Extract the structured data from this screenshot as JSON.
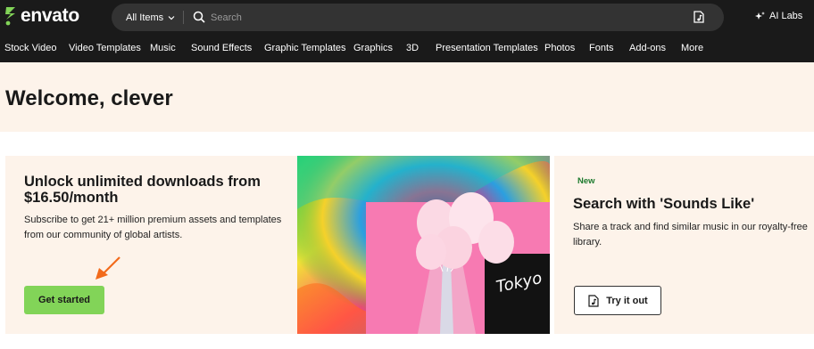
{
  "header": {
    "logo_text": "envato",
    "search": {
      "filter_label": "All Items",
      "placeholder": "Search"
    },
    "ai_labs_label": "AI Labs"
  },
  "categories": [
    "Stock Video",
    "Video Templates",
    "Music",
    "Sound Effects",
    "Graphic Templates",
    "Graphics",
    "3D",
    "Presentation Templates",
    "Photos",
    "Fonts",
    "Add-ons",
    "More"
  ],
  "welcome": {
    "heading": "Welcome, clever"
  },
  "promo": {
    "title": "Unlock unlimited downloads from $16.50/month",
    "description": "Subscribe to get 21+ million premium assets and templates from our community of global artists.",
    "button_label": "Get started"
  },
  "sounds_like": {
    "badge": "New",
    "title": "Search with 'Sounds Like'",
    "description": "Share a track and find similar music in our royalty-free library.",
    "button_label": "Try it out"
  },
  "colors": {
    "topbar_bg": "#1a1a1a",
    "brand_green": "#82d458",
    "cream_bg": "#fdf3ea",
    "arrow_orange": "#f26a1b"
  },
  "icons": [
    "envato-leaf-icon",
    "chevron-down-icon",
    "search-icon",
    "music-search-icon",
    "sparkle-icon",
    "annotation-arrow-icon",
    "music-file-icon"
  ]
}
